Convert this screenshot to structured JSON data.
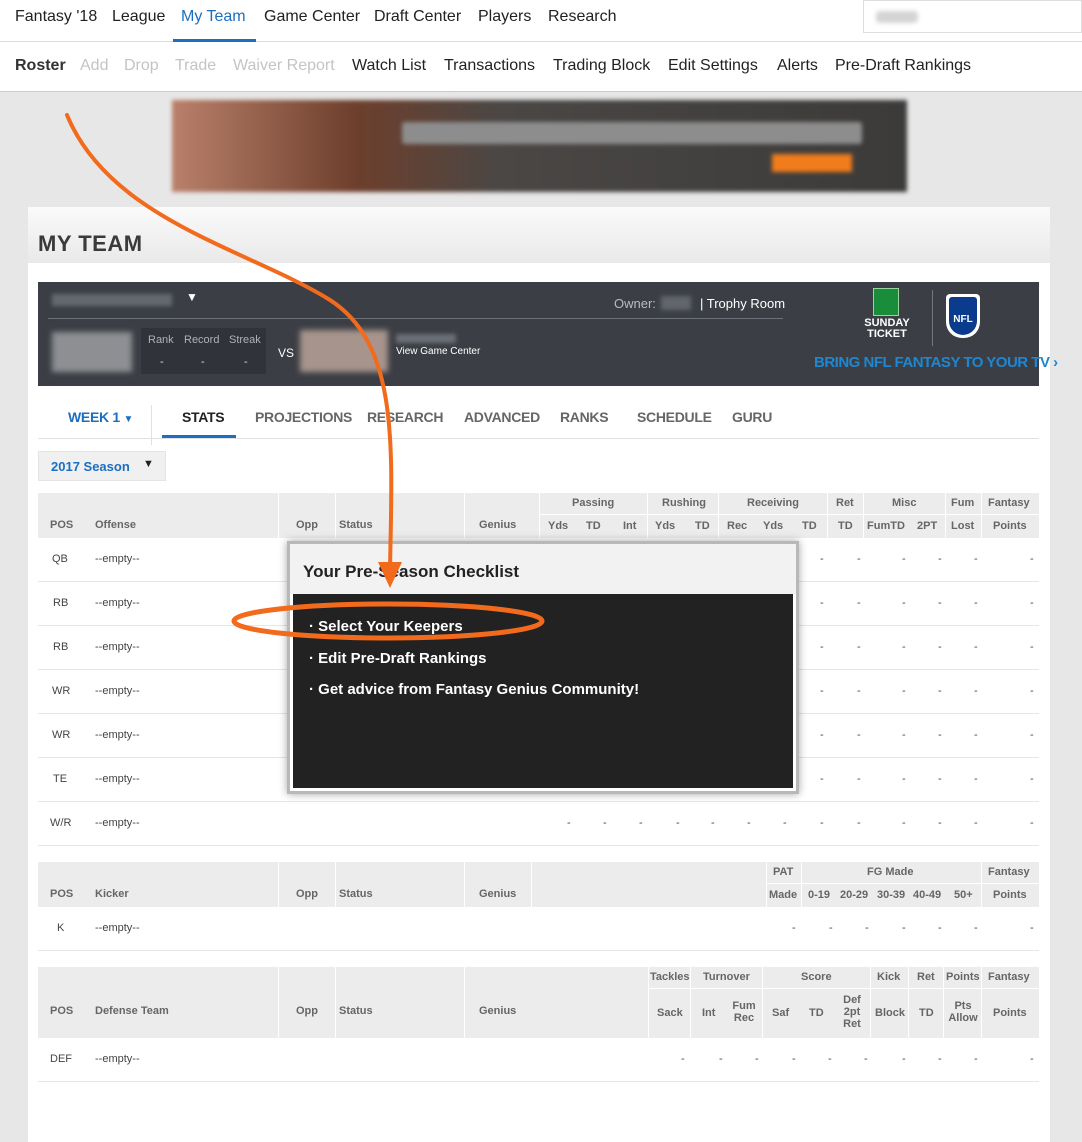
{
  "topnav": {
    "items": [
      {
        "label": "Fantasy '18",
        "active": false
      },
      {
        "label": "League",
        "active": false
      },
      {
        "label": "My Team",
        "active": true
      },
      {
        "label": "Game Center",
        "active": false
      },
      {
        "label": "Draft Center",
        "active": false
      },
      {
        "label": "Players",
        "active": false
      },
      {
        "label": "Research",
        "active": false
      }
    ]
  },
  "subnav": {
    "items": [
      {
        "label": "Roster",
        "state": "current"
      },
      {
        "label": "Add",
        "state": "disabled"
      },
      {
        "label": "Drop",
        "state": "disabled"
      },
      {
        "label": "Trade",
        "state": "disabled"
      },
      {
        "label": "Waiver Report",
        "state": "disabled"
      },
      {
        "label": "Watch List",
        "state": "normal"
      },
      {
        "label": "Transactions",
        "state": "normal"
      },
      {
        "label": "Trading Block",
        "state": "normal"
      },
      {
        "label": "Edit Settings",
        "state": "normal"
      },
      {
        "label": "Alerts",
        "state": "normal"
      },
      {
        "label": "Pre-Draft Rankings",
        "state": "normal"
      }
    ]
  },
  "page_title": "MY TEAM",
  "teambar": {
    "owner_label": "Owner:",
    "trophy_room": "Trophy Room",
    "rank_label": "Rank",
    "record_label": "Record",
    "streak_label": "Streak",
    "rank": "-",
    "record": "-",
    "streak": "-",
    "vs": "VS",
    "view_game_center": "View Game Center",
    "sunday_ticket": "SUNDAY TICKET",
    "nfl_logo_text": "NFL",
    "bring_nfl": "BRING NFL FANTASY TO YOUR TV",
    "chevron": "›"
  },
  "tabs": {
    "week": "WEEK 1",
    "items": [
      "STATS",
      "PROJECTIONS",
      "RESEARCH",
      "ADVANCED",
      "RANKS",
      "SCHEDULE",
      "GURU"
    ],
    "active": "STATS"
  },
  "season_select": "2017 Season",
  "offense": {
    "headers": {
      "pos": "POS",
      "name": "Offense",
      "opp": "Opp",
      "status": "Status",
      "genius": "Genius"
    },
    "groups": [
      "Passing",
      "Rushing",
      "Receiving",
      "Ret",
      "Misc",
      "Fum",
      "Fantasy"
    ],
    "subcols": [
      "Yds",
      "TD",
      "Int",
      "Yds",
      "TD",
      "Rec",
      "Yds",
      "TD",
      "TD",
      "FumTD",
      "2PT",
      "Lost",
      "Points"
    ],
    "rows": [
      {
        "pos": "QB",
        "player": "--empty--"
      },
      {
        "pos": "RB",
        "player": "--empty--"
      },
      {
        "pos": "RB",
        "player": "--empty--"
      },
      {
        "pos": "WR",
        "player": "--empty--"
      },
      {
        "pos": "WR",
        "player": "--empty--"
      },
      {
        "pos": "TE",
        "player": "--empty--"
      },
      {
        "pos": "W/R",
        "player": "--empty--"
      }
    ]
  },
  "kicker": {
    "headers": {
      "pos": "POS",
      "name": "Kicker",
      "opp": "Opp",
      "status": "Status",
      "genius": "Genius"
    },
    "groups": [
      "PAT",
      "FG Made",
      "Fantasy"
    ],
    "subcols": [
      "Made",
      "0-19",
      "20-29",
      "30-39",
      "40-49",
      "50+",
      "Points"
    ],
    "rows": [
      {
        "pos": "K",
        "player": "--empty--"
      }
    ]
  },
  "defense": {
    "headers": {
      "pos": "POS",
      "name": "Defense Team",
      "opp": "Opp",
      "status": "Status",
      "genius": "Genius"
    },
    "groups": [
      "Tackles",
      "Turnover",
      "Score",
      "Kick",
      "Ret",
      "Points",
      "Fantasy"
    ],
    "subcols": [
      "Sack",
      "Int",
      "Fum Rec",
      "Saf",
      "TD",
      "Def 2pt Ret",
      "Block",
      "TD",
      "Pts Allow",
      "Points"
    ],
    "rows": [
      {
        "pos": "DEF",
        "player": "--empty--"
      }
    ]
  },
  "popup": {
    "title": "Your Pre-Season Checklist",
    "items": [
      "· Select Your Keepers",
      "· Edit Pre-Draft Rankings",
      "· Get advice from Fantasy Genius Community!"
    ]
  },
  "empty_value": "-",
  "colors": {
    "accent": "#1b6ec2",
    "annotation": "#f26a1b",
    "teambar": "#3b3f45"
  }
}
